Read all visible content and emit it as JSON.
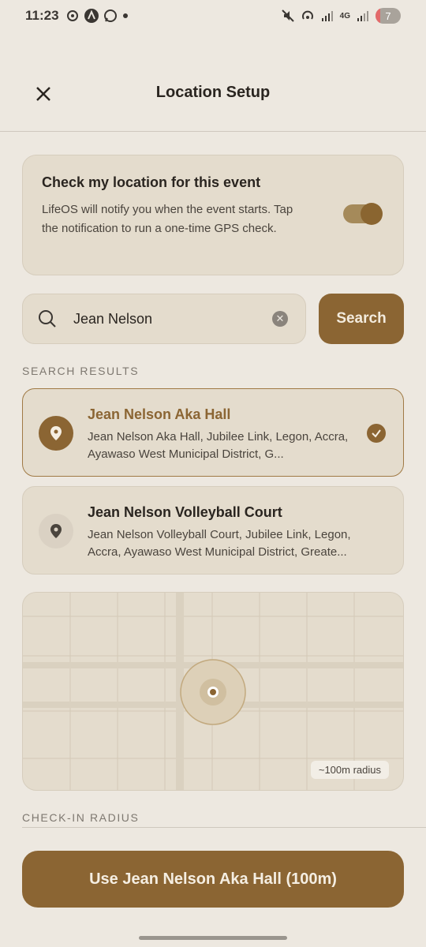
{
  "status_bar": {
    "time": "11:23",
    "battery": "7",
    "network": "4G"
  },
  "header": {
    "title": "Location Setup"
  },
  "location_card": {
    "title": "Check my location for this event",
    "body": "LifeOS will notify you when the event starts. Tap the notification to run a one-time GPS check.",
    "toggle_on": true
  },
  "search": {
    "value": "Jean Nelson",
    "button_label": "Search"
  },
  "results_label": "SEARCH RESULTS",
  "results": [
    {
      "name": "Jean Nelson Aka Hall",
      "address": "Jean Nelson Aka Hall, Jubilee Link, Legon, Accra, Ayawaso West Municipal District, G...",
      "selected": true
    },
    {
      "name": "Jean Nelson Volleyball Court",
      "address": "Jean Nelson Volleyball Court, Jubilee Link, Legon, Accra, Ayawaso West Municipal District, Greate...",
      "selected": false
    }
  ],
  "map": {
    "radius_label": "~100m radius"
  },
  "radius_section_label": "CHECK-IN RADIUS",
  "primary_button": "Use Jean Nelson Aka Hall (100m)",
  "colors": {
    "accent": "#8B6533",
    "background": "#EDE8E0",
    "card": "#E4DCCD"
  }
}
